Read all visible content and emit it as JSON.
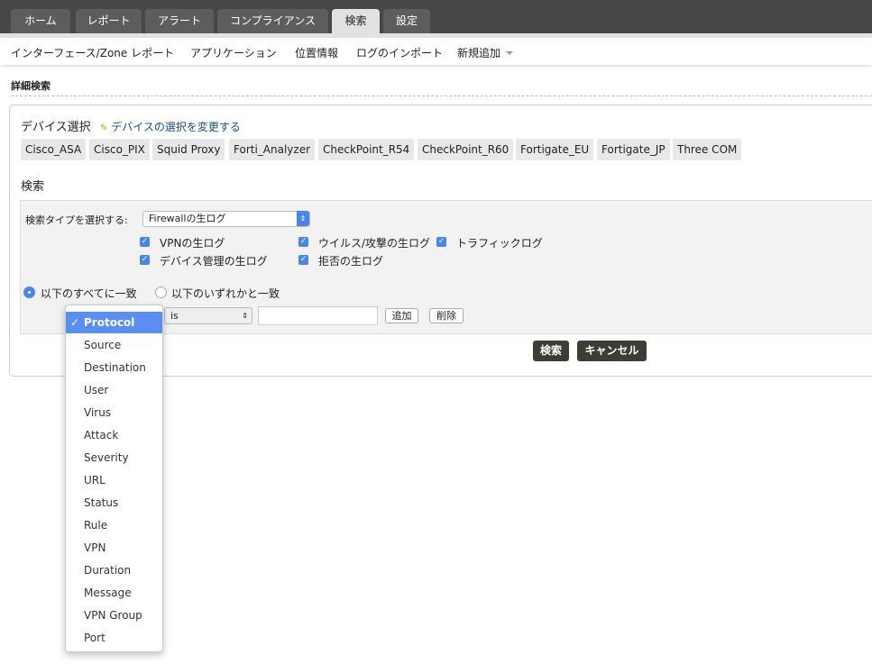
{
  "tabs": [
    "ホーム",
    "レポート",
    "アラート",
    "コンプライアンス",
    "検索",
    "設定"
  ],
  "active_tab": "検索",
  "subnav": [
    "インターフェース/Zone レポート",
    "アプリケーション",
    "位置情報",
    "ログのインポート",
    "新規追加"
  ],
  "page_title": "詳細検索",
  "device": {
    "title": "デバイス選択",
    "change_link": "デバイスの選択を変更する",
    "devices": [
      "Cisco_ASA",
      "Cisco_PIX",
      "Squid Proxy",
      "Forti_Analyzer",
      "CheckPoint_R54",
      "CheckPoint_R60",
      "Fortigate_EU",
      "Fortigate_JP",
      "Three COM"
    ]
  },
  "search": {
    "heading": "検索",
    "type_label": "検索タイプを選択する:",
    "type_value": "Firewallの生ログ",
    "checkboxes": [
      {
        "label": "VPNの生ログ",
        "checked": true
      },
      {
        "label": "ウイルス/攻撃の生ログ",
        "checked": true
      },
      {
        "label": "トラフィックログ",
        "checked": true
      },
      {
        "label": "デバイス管理の生ログ",
        "checked": true
      },
      {
        "label": "拒否の生ログ",
        "checked": true
      }
    ],
    "match_all": "以下のすべてに一致",
    "match_any": "以下のいずれかと一致",
    "match_selected": "all",
    "operator": "is",
    "value": "",
    "add": "追加",
    "delete": "削除"
  },
  "buttons": {
    "search": "検索",
    "cancel": "キャンセル"
  },
  "field_dropdown": {
    "selected": "Protocol",
    "check": "✓",
    "options": [
      "Protocol",
      "Source",
      "Destination",
      "User",
      "Virus",
      "Attack",
      "Severity",
      "URL",
      "Status",
      "Rule",
      "VPN",
      "Duration",
      "Message",
      "VPN Group",
      "Port"
    ]
  }
}
